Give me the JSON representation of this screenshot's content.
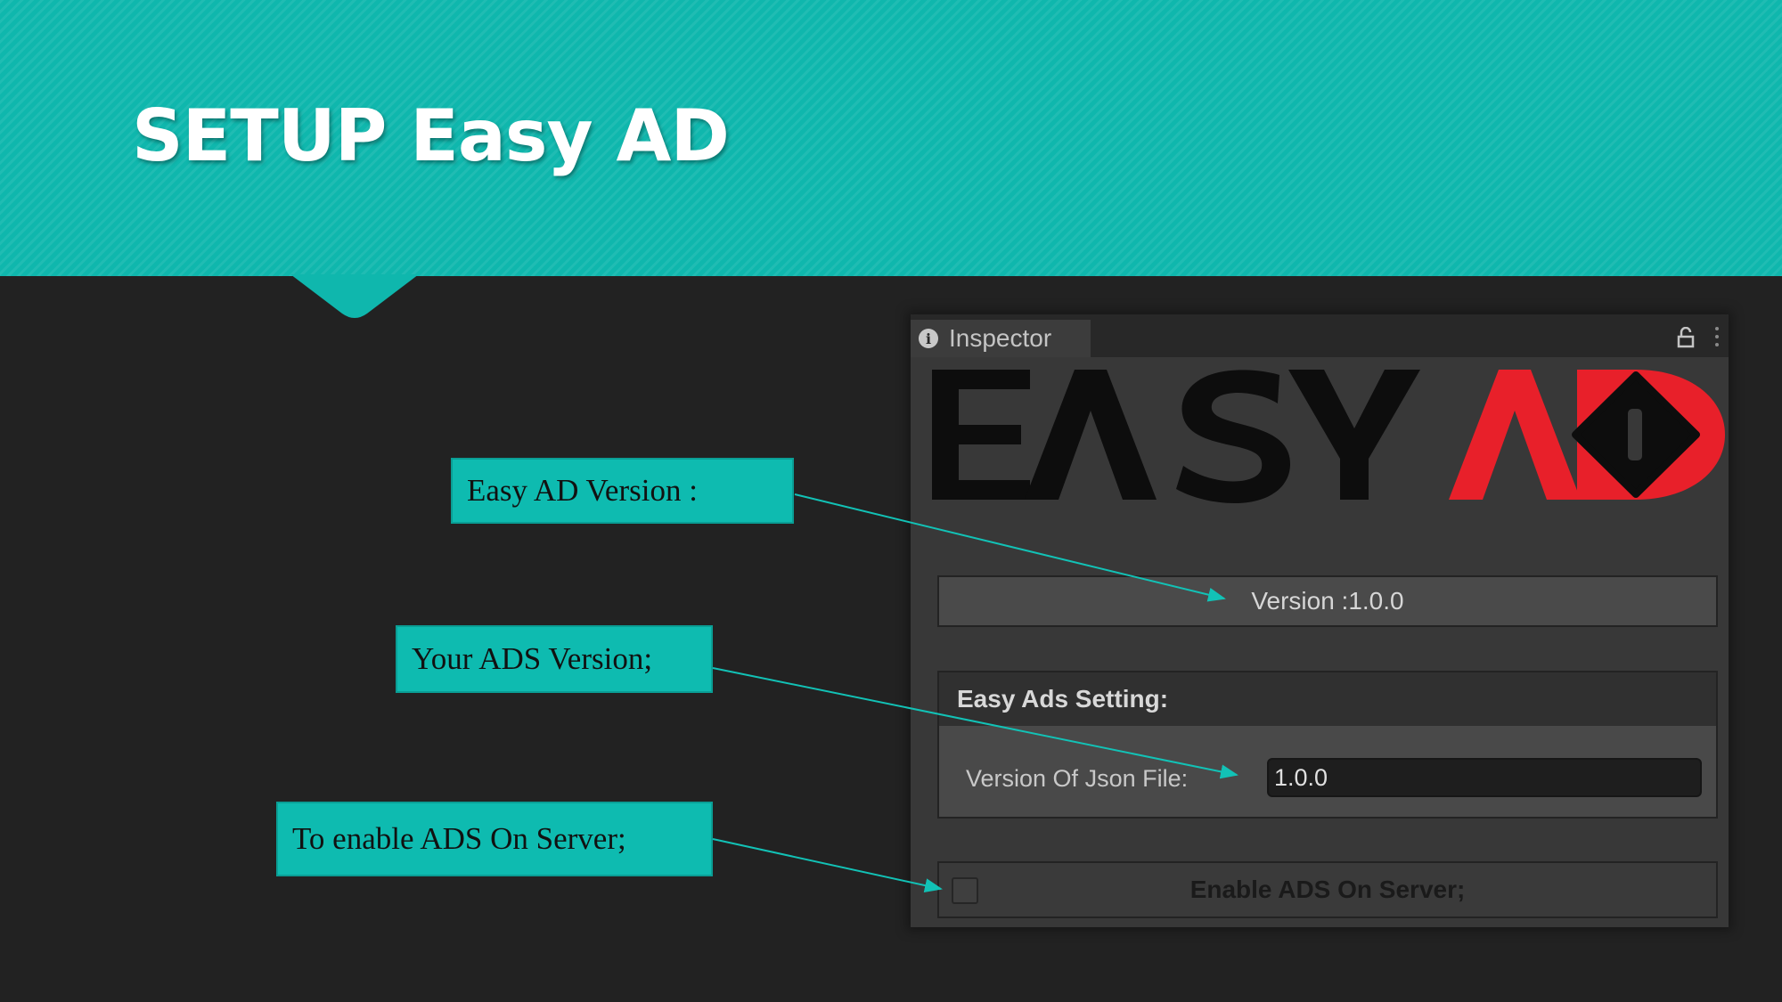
{
  "slide": {
    "title": "SETUP Easy AD",
    "header_color": "#0fb7ad",
    "background_color": "#222222"
  },
  "callouts": [
    {
      "text": "Easy AD Version :"
    },
    {
      "text": "Your ADS Version;"
    },
    {
      "text": "To enable ADS On Server;"
    }
  ],
  "inspector": {
    "tab_label": "Inspector",
    "tab_icon": "info-icon",
    "logo": {
      "text_dark": "EASY",
      "text_red": "AD",
      "accent_color": "#e8202a"
    },
    "version_text": "Version :1.0.0",
    "settings": {
      "heading": "Easy Ads Setting:",
      "json_label": "Version Of Json File:",
      "json_value": "1.0.0"
    },
    "enable_label": "Enable ADS On Server;",
    "enable_checked": false
  }
}
